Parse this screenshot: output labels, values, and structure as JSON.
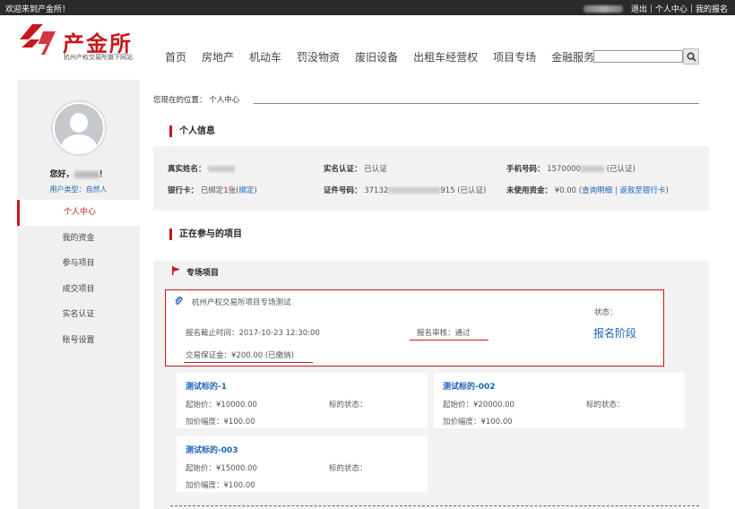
{
  "topbar": {
    "welcome": "欢迎来到产金所！",
    "logout": "退出",
    "separator": "|",
    "personal_center": "个人中心",
    "my_registration": "我的报名"
  },
  "header": {
    "brand": "产金所",
    "brand_sub": "杭州产权交易所旗下网站",
    "nav": [
      "首页",
      "房地产",
      "机动车",
      "罚没物资",
      "废旧设备",
      "出租车经营权",
      "项目专场",
      "金融服务"
    ],
    "search_placeholder": ""
  },
  "sidebar": {
    "hello_prefix": "您好，",
    "hello_suffix": "！",
    "user_type": "用户类型：自然人",
    "menu": [
      "个人中心",
      "我的资金",
      "参与项目",
      "成交项目",
      "实名认证",
      "账号设置"
    ],
    "active_index": 0
  },
  "breadcrumb": "您现在的位置：  个人中心",
  "personal_info": {
    "title": "个人信息",
    "real_name_label": "真实姓名：",
    "real_name_auth_label": "实名认证：",
    "real_name_auth_value": "已认证",
    "phone_label": "手机号码：",
    "phone_prefix": "1570000",
    "phone_status": "(已认证)",
    "bank_label": "银行卡：",
    "bank_text_a": "已绑定",
    "bank_count": "1",
    "bank_text_b": "张(",
    "bank_bind": "绑定",
    "bank_text_c": ")",
    "id_label": "证件号码：",
    "id_prefix": "37132",
    "id_suffix": "915",
    "id_status": "(已认证)",
    "unused_label": "未使用资金：",
    "unused_value": "¥0.00",
    "query_detail": "查询明细",
    "refund": "返款至银行卡"
  },
  "projects": {
    "title": "正在参与的项目",
    "subtitle": "专场项目",
    "card": {
      "name": "杭州产权交易所项目专场测试",
      "deadline_label": "报名截止时间：",
      "deadline_value": "2017-10-23 12:30:00",
      "review_label": "报名审核：",
      "review_value": "通过",
      "deposit_label": "交易保证金：",
      "deposit_value": "¥200.00 (已缴纳)",
      "status_label": "状态：",
      "stage": "报名阶段"
    },
    "lots": [
      {
        "name": "测试标的-1",
        "start_price": "起始价：¥10000.00",
        "status": "标的状态：",
        "increment": "加价幅度：¥100.00"
      },
      {
        "name": "测试标的-002",
        "start_price": "起始价：¥20000.00",
        "status": "标的状态：",
        "increment": "加价幅度：¥100.00"
      },
      {
        "name": "测试标的-003",
        "start_price": "起始价：¥15000.00",
        "status": "标的状态：",
        "increment": "加价幅度：¥100.00"
      }
    ]
  },
  "colors": {
    "accent": "#c8161d",
    "link": "#1c63b7",
    "topbar": "#2b2b2b"
  }
}
